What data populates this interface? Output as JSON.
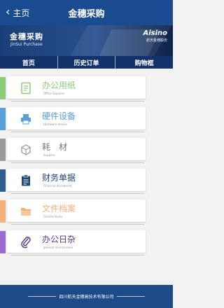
{
  "header": {
    "back_label": "主页",
    "title": "金穗采购"
  },
  "banner": {
    "title": "金穗采购",
    "subtitle": "JinSui Purchase",
    "logo_text": "Aisino",
    "logo_subtext": "航天金穗股份"
  },
  "tabs": [
    {
      "label": "首页"
    },
    {
      "label": "历史订单"
    },
    {
      "label": "购物框"
    }
  ],
  "menu": [
    {
      "label": "办公用纸",
      "sublabel": "Office Supplies",
      "color": "#8ccc78",
      "label_color": "#8ccc78",
      "icon": "document-icon"
    },
    {
      "label": "硬件设备",
      "sublabel": "Hardware device",
      "color": "#5aa0d6",
      "label_color": "#5aa0d6",
      "icon": "printer-icon"
    },
    {
      "label": "耗　材",
      "sublabel": "Supplies",
      "color": "#9a9a9a",
      "label_color": "#777777",
      "icon": "cube-icon"
    },
    {
      "label": "财务单据",
      "sublabel": "Financial documents",
      "color": "#2f5f8e",
      "label_color": "#1f4a78",
      "icon": "notepad-icon"
    },
    {
      "label": "文件档案",
      "sublabel": "Files/Archives",
      "color": "#f4b07a",
      "label_color": "#f4b07a",
      "icon": "folder-icon"
    },
    {
      "label": "办公日杂",
      "sublabel": "general merchandise",
      "color": "#9b6bd0",
      "label_color": "#5a3a8a",
      "icon": "paperclip-icon"
    }
  ],
  "footer": {
    "text": "四川航天金穗高技术有限公司"
  }
}
